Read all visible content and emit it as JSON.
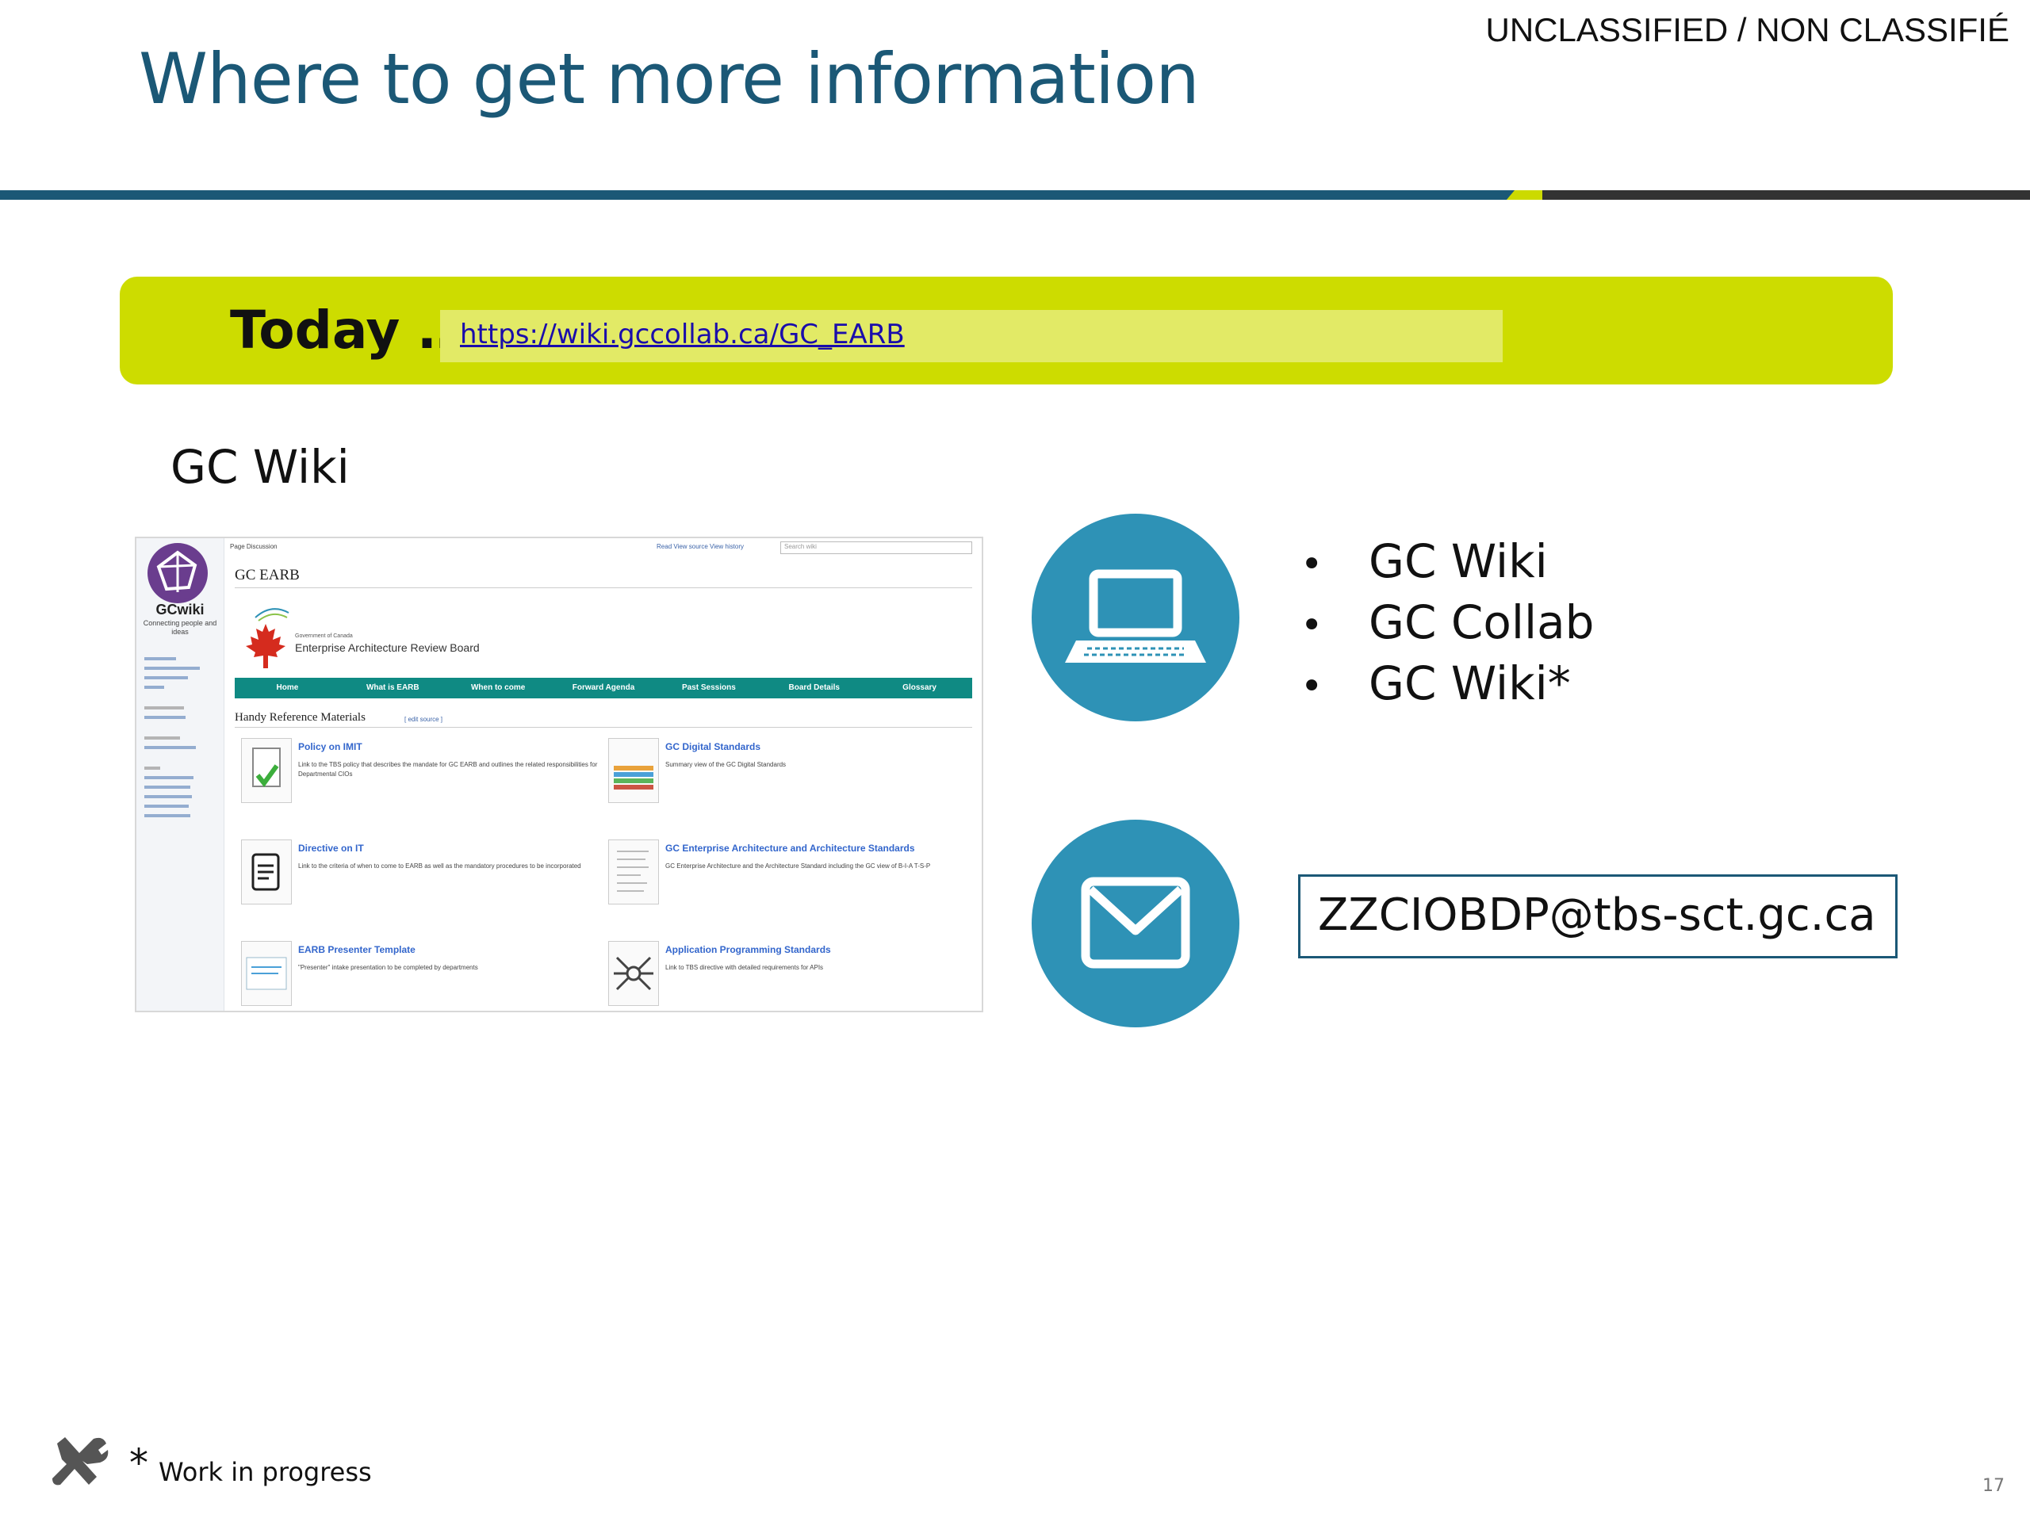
{
  "slide": {
    "title": "Where to get more information",
    "classification": "UNCLASSIFIED / NON CLASSIFIÉ",
    "page_number": "17"
  },
  "banner": {
    "label": "Today …",
    "url": "https://wiki.gccollab.ca/GC_EARB"
  },
  "section_label": "GC Wiki",
  "screenshot": {
    "logo_text": "GCwiki",
    "logo_sub": "Connecting people and ideas",
    "top_tabs": "Page   Discussion",
    "right_tabs": "Read   View source   View history",
    "search_placeholder": "Search wiki",
    "page_title": "GC EARB",
    "gov_text": "Government of Canada",
    "board_name": "Enterprise Architecture Review Board",
    "nav": [
      "Home",
      "What is EARB",
      "When to come",
      "Forward Agenda",
      "Past Sessions",
      "Board Details",
      "Glossary"
    ],
    "section_heading": "Handy Reference Materials",
    "edit_link": "[ edit source ]",
    "cards": [
      {
        "title": "Policy on IMIT",
        "desc": "Link to the TBS policy that describes the mandate for GC EARB and outlines the related responsibilities for Departmental CIOs"
      },
      {
        "title": "GC Digital Standards",
        "desc": "Summary view of the GC Digital Standards"
      },
      {
        "title": "Directive on IT",
        "desc": "Link to the criteria of when to come to EARB as well as the mandatory procedures to be incorporated"
      },
      {
        "title": "GC Enterprise Architecture and Architecture Standards",
        "desc": "GC Enterprise Architecture and the Architecture Standard including the GC view of B-I-A T-S-P"
      },
      {
        "title": "EARB Presenter Template",
        "desc": "\"Presenter\" intake presentation to be completed by departments"
      },
      {
        "title": "Application Programming Standards",
        "desc": "Link to TBS directive with detailed requirements for APIs"
      }
    ]
  },
  "resources": {
    "laptop_icon": "laptop-icon",
    "items": [
      "GC Wiki",
      "GC Collab",
      "GC Wiki*"
    ],
    "mail_icon": "envelope-icon",
    "email": "ZZCIOBDP@tbs-sct.gc.ca"
  },
  "footer": {
    "icon": "tools-icon",
    "asterisk": "*",
    "note": "Work in progress"
  },
  "colors": {
    "title": "#1b5876",
    "banner": "#cddc00",
    "circle": "#2e92b6",
    "nav": "#0f8a83"
  }
}
